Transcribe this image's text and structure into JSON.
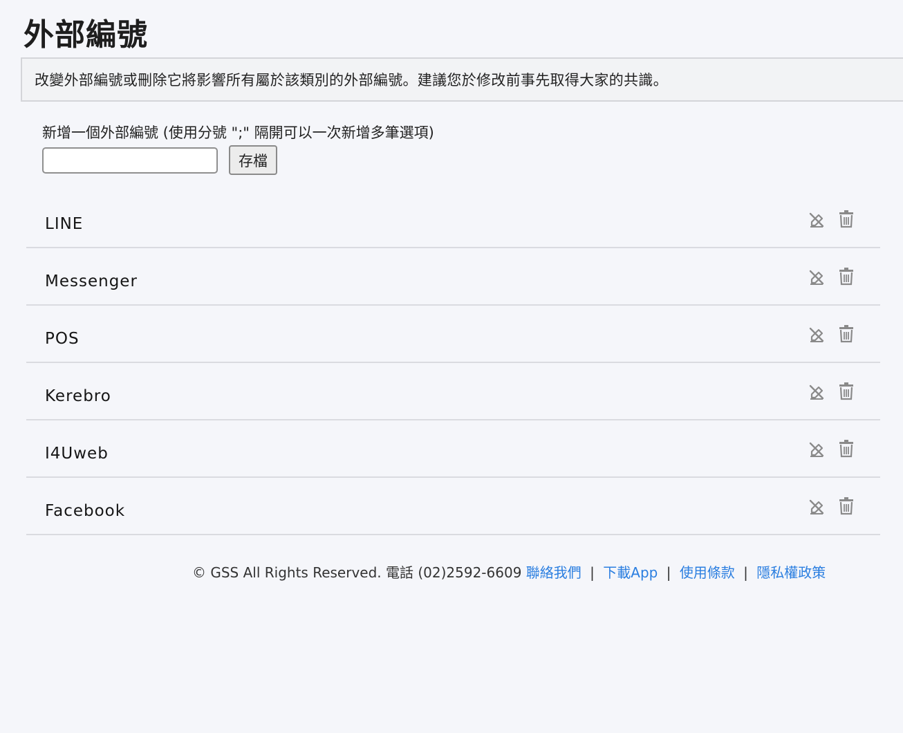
{
  "page": {
    "title": "外部編號",
    "notice": "改變外部編號或刪除它將影響所有屬於該類別的外部編號。建議您於修改前事先取得大家的共識。"
  },
  "add_form": {
    "label": "新增一個外部編號  (使用分號 \";\" 隔開可以一次新增多筆選項)",
    "input_value": "",
    "input_placeholder": "",
    "save_label": "存檔"
  },
  "items": [
    {
      "label": "LINE"
    },
    {
      "label": "Messenger"
    },
    {
      "label": "POS"
    },
    {
      "label": "Kerebro"
    },
    {
      "label": "I4Uweb"
    },
    {
      "label": "Facebook"
    }
  ],
  "row_icons": [
    "edit-icon",
    "trash-icon"
  ],
  "footer": {
    "copyright": "© GSS All Rights Reserved. 電話 (02)2592-6609",
    "links": [
      "聯絡我們",
      "下載App",
      "使用條款",
      "隱私權政策"
    ],
    "separator": "|"
  },
  "colors": {
    "background": "#f5f6fa",
    "link": "#2a7ee0",
    "icon": "#8a8a8a"
  }
}
